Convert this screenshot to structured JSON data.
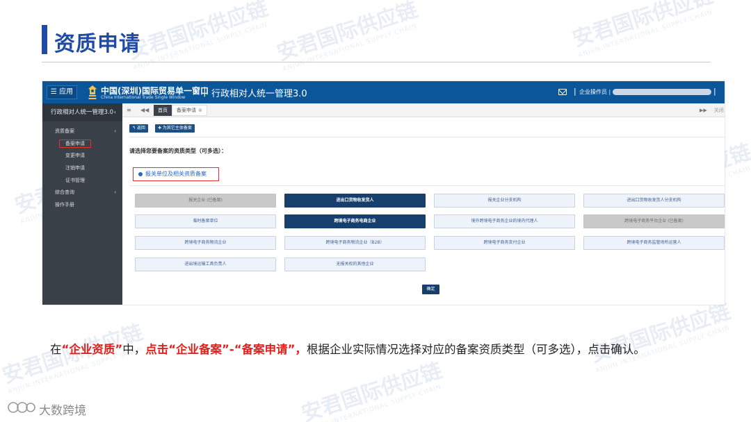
{
  "slide": {
    "title": "资质申请",
    "watermark_cn": "安君国际供应链",
    "watermark_en": "ANJUN INTERNATIONAL SUPPLY CHAIN",
    "caption": {
      "p1": "在",
      "p2": "“企业资质”",
      "p3": "中，",
      "p4": "点击“企业备案”-“备案申请”，",
      "p5": "根据企业实际情况选择对应的备案资质类型（可多选），点击确认。"
    },
    "bottom_logo_text": "大数跨境"
  },
  "app": {
    "menu_label": "☰ 应用",
    "brand_cn": "中国(深圳)国际贸易单一窗口",
    "brand_en": "China International Trade Single Window",
    "brand_sep": "|",
    "brand_sub": "行政相对人统一管理3.0",
    "header_sep": "|",
    "operator_label": "企业操作员 |",
    "header_sep_end": "|",
    "sidebar": {
      "title": "行政相对人统一管理3.0",
      "title_chevron": "‹",
      "items": [
        {
          "label": "资质备案",
          "chevron": "‹"
        },
        {
          "label": "备案申请"
        },
        {
          "label": "变更申请"
        },
        {
          "label": "注销申请"
        },
        {
          "label": "证书管理"
        },
        {
          "label": "综合查询",
          "chevron": "‹"
        },
        {
          "label": "操作手册"
        }
      ]
    },
    "tabs": {
      "menu_icon": "≡",
      "back_icon": "◀◀",
      "home": "首页",
      "current": "备案申请",
      "close": "⊗",
      "next_icon": "▶▶",
      "close_label": "关闭"
    },
    "actions": {
      "back": "↰ 返回",
      "add_other": "✚ 为其它主体备案"
    },
    "prompt": "请选择您要备案的资质类型（可多选）：",
    "radio_label": "报关单位及相关资质备案",
    "options": [
      {
        "label": "报关企业 (已备案)",
        "state": "disabled"
      },
      {
        "label": "进出口货物收发货人",
        "state": "selected"
      },
      {
        "label": "报关企业分支机构",
        "state": "normal"
      },
      {
        "label": "进出口货物收发货人分支机构",
        "state": "normal"
      },
      {
        "label": "临时备案单位",
        "state": "normal"
      },
      {
        "label": "跨境电子商务电商企业",
        "state": "selected"
      },
      {
        "label": "境外跨境电子商务企业的境内代理人",
        "state": "normal"
      },
      {
        "label": "跨境电子商务平台企业 (已备案)",
        "state": "disabled"
      },
      {
        "label": "跨境电子商务物流企业",
        "state": "normal"
      },
      {
        "label": "跨境电子商务物流企业（B2B）",
        "state": "normal"
      },
      {
        "label": "跨境电子商务支付企业",
        "state": "normal"
      },
      {
        "label": "跨境电子商务监管场所运营人",
        "state": "normal"
      },
      {
        "label": "进出境运输工具负责人",
        "state": "normal"
      },
      {
        "label": "无报关权的其他企业",
        "state": "normal"
      }
    ],
    "confirm_label": "确定"
  },
  "colors": {
    "brand_blue": "#1f4aa5",
    "header_blue": "#0b5599",
    "selected_navy": "#163f6b",
    "highlight_red": "#e0342a"
  }
}
